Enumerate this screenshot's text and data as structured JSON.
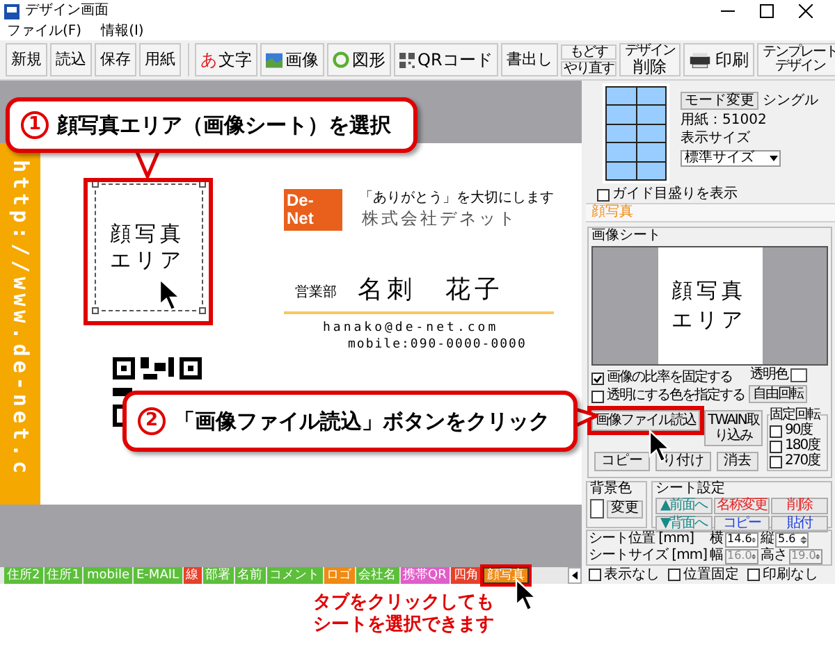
{
  "window": {
    "title": "デザイン画面"
  },
  "menu": [
    "ファイル(F)",
    "情報(I)"
  ],
  "toolbar": [
    [
      {
        "kind": "plain",
        "label": "新規"
      },
      {
        "kind": "plain",
        "label": "読込"
      },
      {
        "kind": "plain",
        "label": "保存"
      },
      {
        "kind": "plain",
        "label": "用紙"
      }
    ],
    [
      {
        "kind": "text",
        "glyph": "あ",
        "label": "文字"
      },
      {
        "kind": "image",
        "label": "画像"
      },
      {
        "kind": "shape",
        "label": "図形"
      },
      {
        "kind": "qr",
        "label": "QRコード"
      },
      {
        "kind": "plain",
        "label": "書出し"
      },
      {
        "kind": "stack",
        "lines": [
          "もどす",
          "やり直す"
        ]
      },
      {
        "kind": "delete",
        "lines": [
          "デザイン",
          "削除"
        ]
      },
      {
        "kind": "print",
        "label": "印刷"
      },
      {
        "kind": "template",
        "lines": [
          "テンプレート",
          "デザイン"
        ]
      }
    ]
  ],
  "card": {
    "url": "http://www.de-net.c",
    "photo_area": {
      "lines": [
        "顔写真",
        "エリア"
      ],
      "selected": true
    },
    "logo": [
      "De-",
      "Net"
    ],
    "slogan": "「ありがとう」を大切にします",
    "company": "株式会社デネット",
    "department": "営業部",
    "name": "名刺　花子",
    "email": "hanako@de-net.com",
    "mobile": "mobile:090-0000-0000"
  },
  "callouts": [
    {
      "number": "1",
      "text": "顔写真エリア（画像シート）を選択"
    },
    {
      "number": "2",
      "text": "「画像ファイル読込」ボタンをクリック"
    }
  ],
  "tabs": [
    {
      "label": "住所2",
      "color": "#5cbf3a",
      "selected": false
    },
    {
      "label": "住所1",
      "color": "#5cbf3a",
      "selected": false
    },
    {
      "label": "mobile",
      "color": "#5cbf3a",
      "selected": false
    },
    {
      "label": "E-MAIL",
      "color": "#5cbf3a",
      "selected": false
    },
    {
      "label": "線",
      "color": "#e8402a",
      "selected": false
    },
    {
      "label": "部署",
      "color": "#5cbf3a",
      "selected": false
    },
    {
      "label": "名前",
      "color": "#5cbf3a",
      "selected": false
    },
    {
      "label": "コメント",
      "color": "#5cbf3a",
      "selected": false
    },
    {
      "label": "ロゴ",
      "color": "#f08a12",
      "selected": false
    },
    {
      "label": "会社名",
      "color": "#5cbf3a",
      "selected": false
    },
    {
      "label": "携帯QR",
      "color": "#e05ec8",
      "selected": false
    },
    {
      "label": "四角",
      "color": "#e8402a",
      "selected": false
    },
    {
      "label": "顔写真",
      "color": "#f08a12",
      "selected": true
    }
  ],
  "note": [
    "タブをクリックしても",
    "シートを選択できます"
  ],
  "layout_panel": {
    "mode_button": "モード変更",
    "mode": "シングル",
    "paper": "用紙：51002",
    "display_size_label": "表示サイズ",
    "display_size": "標準サイズ",
    "guide": {
      "label": "ガイド目盛りを表示",
      "checked": false
    }
  },
  "sheet_panel": {
    "title": "顔写真",
    "group_title": "画像シート",
    "preview_lines": [
      "顔写真",
      "エリア"
    ],
    "options": [
      {
        "label": "画像の比率を固定する",
        "checked": true
      },
      {
        "label": "透明にする色を指定する",
        "checked": false
      }
    ],
    "transparent_label": "透明色",
    "rotate_button": "自由回転",
    "buttons": [
      {
        "label": "画像ファイル読込",
        "highlighted": true
      },
      {
        "label": "TWAIN取り込み",
        "highlighted": false
      },
      {
        "label": "コピー",
        "highlighted": false
      },
      {
        "label": "り付け",
        "highlighted": false
      },
      {
        "label": "消去",
        "highlighted": false
      }
    ],
    "fixed_rotation": {
      "title": "固定回転",
      "options": [
        {
          "label": "90度",
          "checked": false
        },
        {
          "label": "180度",
          "checked": false
        },
        {
          "label": "270度",
          "checked": false
        }
      ]
    }
  },
  "background": {
    "title": "背景色",
    "button": "変更"
  },
  "sheet_settings": {
    "title": "シート設定",
    "buttons": [
      {
        "label": "▲前面へ",
        "color": "#1a8a8a"
      },
      {
        "label": "名称変更",
        "color": "#e82020"
      },
      {
        "label": "削除",
        "color": "#e82020"
      },
      {
        "label": "▼背面へ",
        "color": "#1a8a8a"
      },
      {
        "label": "コピー",
        "color": "#2040e0"
      },
      {
        "label": "貼付",
        "color": "#2040e0"
      }
    ]
  },
  "geometry": [
    {
      "label": "シート位置 [mm]",
      "fields": [
        {
          "label": "横",
          "value": "14.6",
          "disabled": false
        },
        {
          "label": "縦",
          "value": "5.6",
          "disabled": false
        }
      ]
    },
    {
      "label": "シートサイズ [mm]",
      "fields": [
        {
          "label": "幅",
          "value": "16.0",
          "disabled": true
        },
        {
          "label": "高さ",
          "value": "19.0",
          "disabled": true
        }
      ]
    }
  ],
  "sheet_flags": [
    {
      "label": "表示なし",
      "checked": false
    },
    {
      "label": "位置固定",
      "checked": false
    },
    {
      "label": "印刷なし",
      "checked": false
    }
  ]
}
